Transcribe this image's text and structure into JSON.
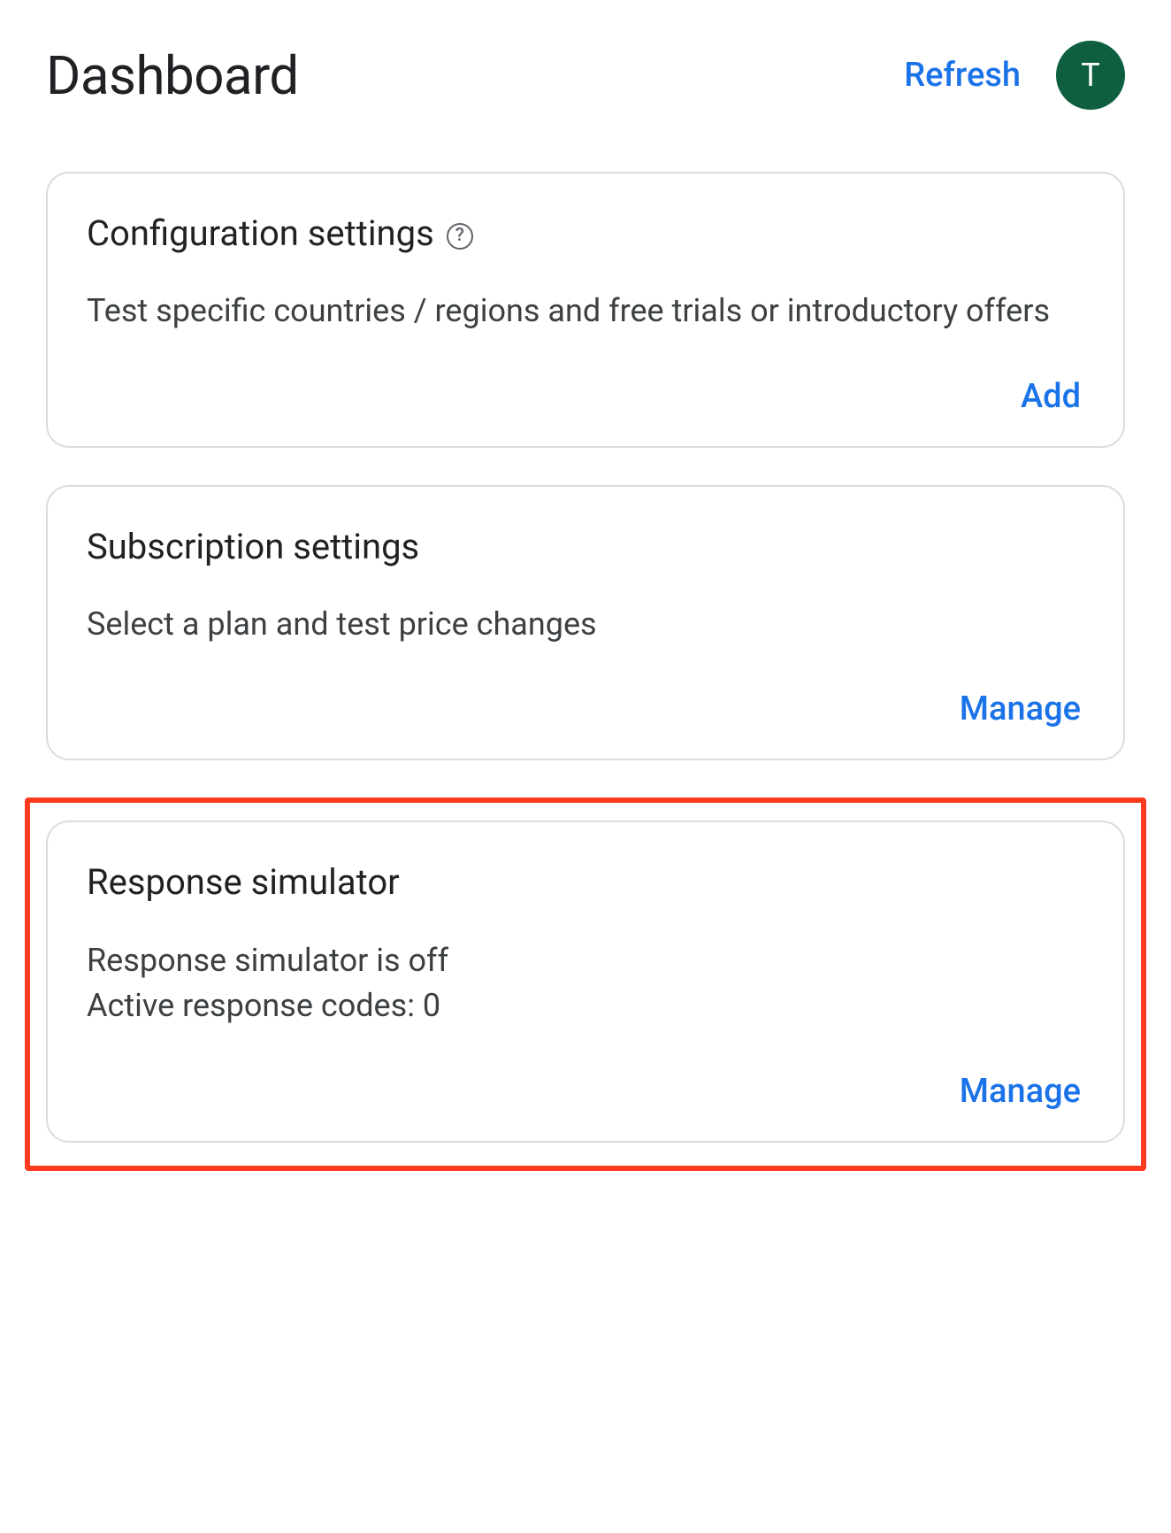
{
  "header": {
    "title": "Dashboard",
    "refresh_label": "Refresh",
    "avatar_initial": "T"
  },
  "cards": {
    "configuration": {
      "title": "Configuration settings",
      "has_help": true,
      "description": "Test specific countries / regions and free trials or introductory offers",
      "action_label": "Add"
    },
    "subscription": {
      "title": "Subscription settings",
      "description": "Select a plan and test price changes",
      "action_label": "Manage"
    },
    "response_simulator": {
      "title": "Response simulator",
      "status_line": "Response simulator is off",
      "codes_line": "Active response codes: 0",
      "action_label": "Manage",
      "highlighted": true
    }
  }
}
